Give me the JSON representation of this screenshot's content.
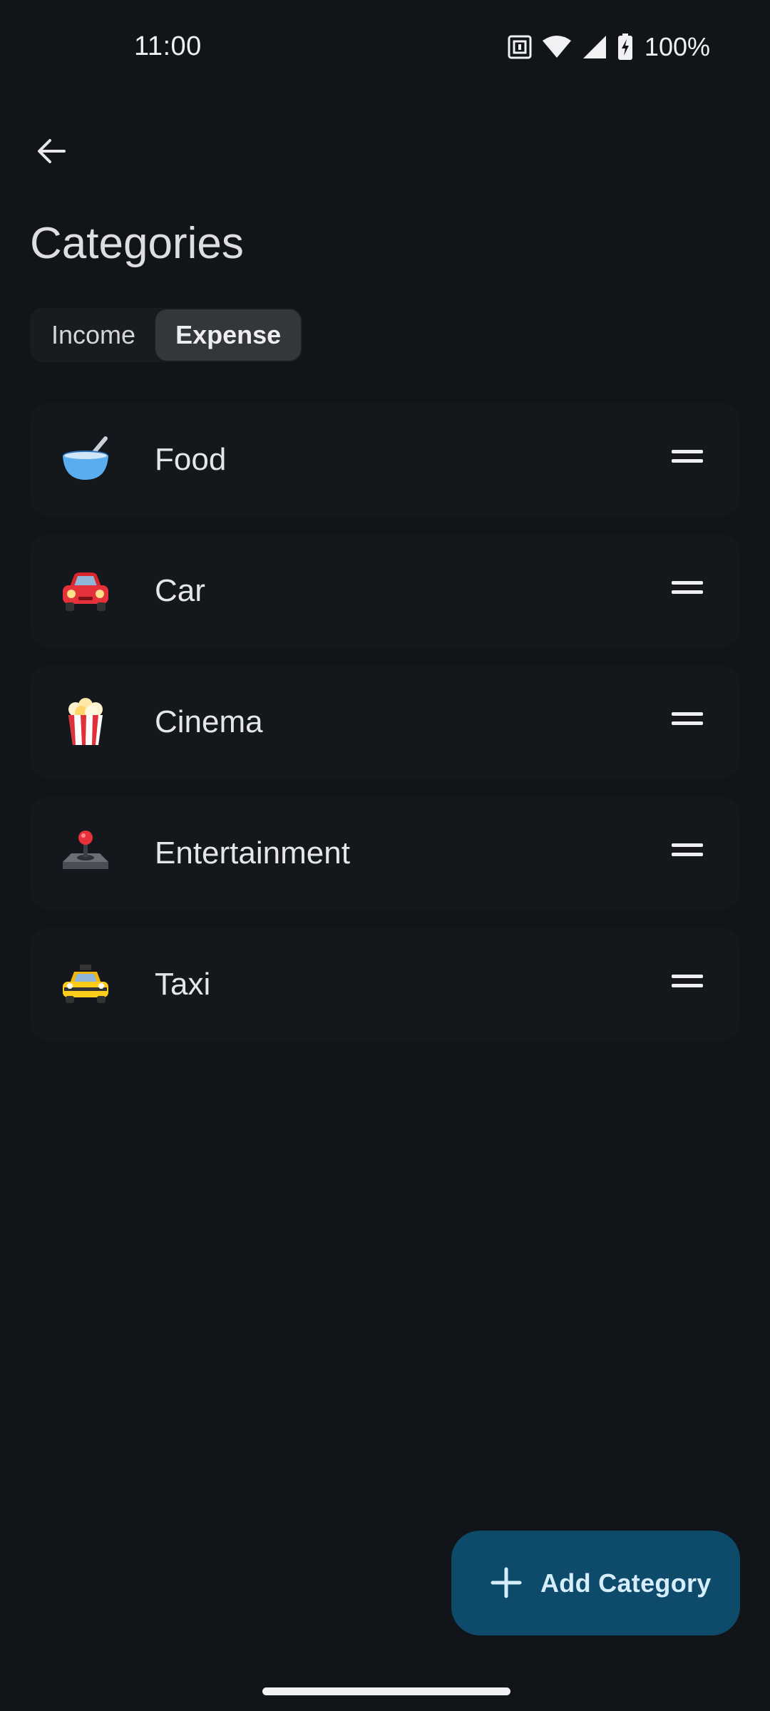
{
  "status_bar": {
    "time": "11:00",
    "battery": "100%",
    "icons": [
      "nfc-icon",
      "wifi-icon",
      "cell-signal-icon",
      "battery-charging-icon"
    ]
  },
  "app_bar": {
    "back_icon": "arrow-back-icon",
    "title": "Categories"
  },
  "segmented": {
    "options": [
      "Income",
      "Expense"
    ],
    "selected": "Expense"
  },
  "categories": [
    {
      "label": "Food",
      "icon": "bowl-icon"
    },
    {
      "label": "Car",
      "icon": "car-icon"
    },
    {
      "label": "Cinema",
      "icon": "popcorn-icon"
    },
    {
      "label": "Entertainment",
      "icon": "joystick-icon"
    },
    {
      "label": "Taxi",
      "icon": "taxi-icon"
    }
  ],
  "fab": {
    "label": "Add Category",
    "icon": "plus-icon"
  },
  "colors": {
    "background": "#111418",
    "card": "#14171b",
    "segment_active": "#33363b",
    "fab_background": "#0e4a6a",
    "fab_text": "#d6eefc"
  }
}
